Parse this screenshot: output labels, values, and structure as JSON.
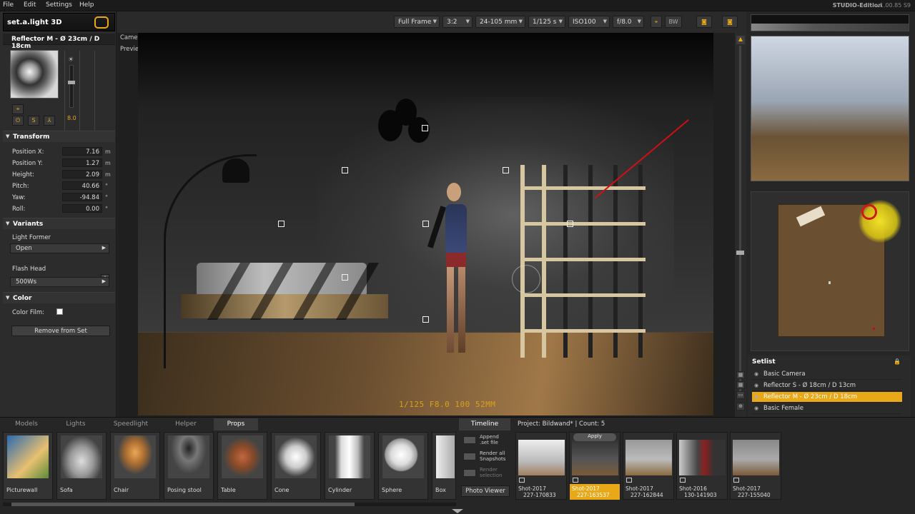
{
  "menu": {
    "file": "File",
    "edit": "Edit",
    "settings": "Settings",
    "help": "Help",
    "edition": "STUDIO-Edition",
    "version": "v1.00.85   S9"
  },
  "toolbar": {
    "format": "Full Frame",
    "ratio": "3:2",
    "lens": "24-105 mm",
    "shutter": "1/125 s",
    "iso": "ISO100",
    "aperture": "f/8.0",
    "bw": "BW"
  },
  "left": {
    "logo": "set.a.light 3D",
    "title": "Reflector M - Ø 23cm / D 18cm",
    "intensity": "8.0",
    "icons": {
      "power": "⏻",
      "s": "S",
      "tripod": "⅄",
      "target": "⌖"
    },
    "transform": {
      "title": "Transform",
      "position_x": {
        "label": "Position X:",
        "value": "7.16",
        "unit": "m"
      },
      "position_y": {
        "label": "Position Y:",
        "value": "1.27",
        "unit": "m"
      },
      "height": {
        "label": "Height:",
        "value": "2.09",
        "unit": "m"
      },
      "pitch": {
        "label": "Pitch:",
        "value": "40.66",
        "unit": "°"
      },
      "yaw": {
        "label": "Yaw:",
        "value": "-94.84",
        "unit": "°"
      },
      "roll": {
        "label": "Roll:",
        "value": "0.00",
        "unit": "°"
      }
    },
    "variants": {
      "title": "Variants",
      "light_former_label": "Light Former",
      "light_former": "Open",
      "flash_head_label": "Flash Head",
      "flash_head": "500Ws"
    },
    "color": {
      "title": "Color",
      "film_label": "Color Film:"
    },
    "remove": "Remove from Set"
  },
  "viewport": {
    "label1": "Camera",
    "label2": "Preview",
    "overlay": "1/125  F8.0  100  52MM"
  },
  "setlist": {
    "title": "Setlist",
    "items": [
      {
        "label": "Basic Camera"
      },
      {
        "label": "Reflector S - Ø 18cm / D 13cm"
      },
      {
        "label": "Reflector M - Ø 23cm / D 18cm"
      },
      {
        "label": "Basic Female"
      }
    ]
  },
  "bottom": {
    "tabs": [
      "Models",
      "Lights",
      "Speedlight",
      "Helper",
      "Props"
    ],
    "props": [
      "Picturewall",
      "Sofa",
      "Chair",
      "Posing stool",
      "Table",
      "Cone",
      "Cylinder",
      "Sphere",
      "Box"
    ],
    "timeline_tab": "Timeline",
    "project": "Project: Bildwand*  |  Count: 5",
    "actions": {
      "append": "Append\n.set file",
      "render_all": "Render all\nSnapshots",
      "render_sel": "Render\nselection"
    },
    "photo_viewer": "Photo Viewer",
    "apply": "Apply",
    "shots": [
      {
        "l1": "Shot-2017",
        "l2": "227-170833"
      },
      {
        "l1": "Shot-2017",
        "l2": "227-163537"
      },
      {
        "l1": "Shot-2017",
        "l2": "227-162844"
      },
      {
        "l1": "Shot-2016",
        "l2": "130-141903"
      },
      {
        "l1": "Shot-2017",
        "l2": "227-155040"
      }
    ]
  },
  "colors": {
    "accent": "#e8a818",
    "laser": "#d01010"
  }
}
